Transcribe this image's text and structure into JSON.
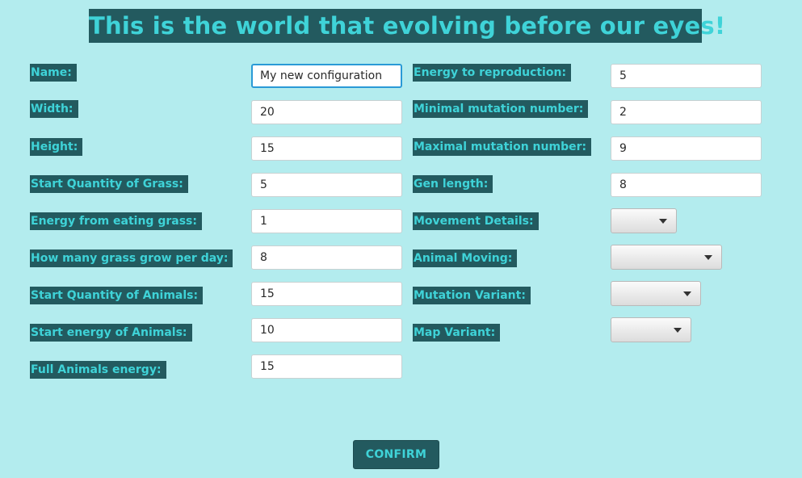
{
  "title": "This is the world that evolving before our eyes!",
  "left_fields": [
    {
      "label": "Name:",
      "value": "My new configuration"
    },
    {
      "label": "Width:",
      "value": "20"
    },
    {
      "label": "Height:",
      "value": "15"
    },
    {
      "label": "Start Quantity of Grass:",
      "value": "5"
    },
    {
      "label": "Energy from eating grass:",
      "value": "1"
    },
    {
      "label": "How many grass grow per day:",
      "value": "8"
    },
    {
      "label": "Start Quantity of Animals:",
      "value": "15"
    },
    {
      "label": "Start energy of Animals:",
      "value": "10"
    },
    {
      "label": "Full Animals energy:",
      "value": "15"
    }
  ],
  "right_fields": [
    {
      "label": "Energy to reproduction:",
      "value": "5"
    },
    {
      "label": "Minimal mutation number:",
      "value": "2"
    },
    {
      "label": "Maximal mutation number:",
      "value": "9"
    },
    {
      "label": "Gen length:",
      "value": "8"
    }
  ],
  "dropdowns": [
    {
      "label": "Movement Details:",
      "selected": ""
    },
    {
      "label": "Animal Moving:",
      "selected": ""
    },
    {
      "label": "Mutation Variant:",
      "selected": ""
    },
    {
      "label": "Map Variant:",
      "selected": ""
    }
  ],
  "confirm_label": "CONFIRM",
  "icons": {
    "dropdown_arrow": "chevron-down-icon"
  },
  "colors": {
    "background": "#b3ecee",
    "label_bg": "#235a5f",
    "label_text": "#3fd3d8",
    "focus_border": "#2a9ad6"
  }
}
